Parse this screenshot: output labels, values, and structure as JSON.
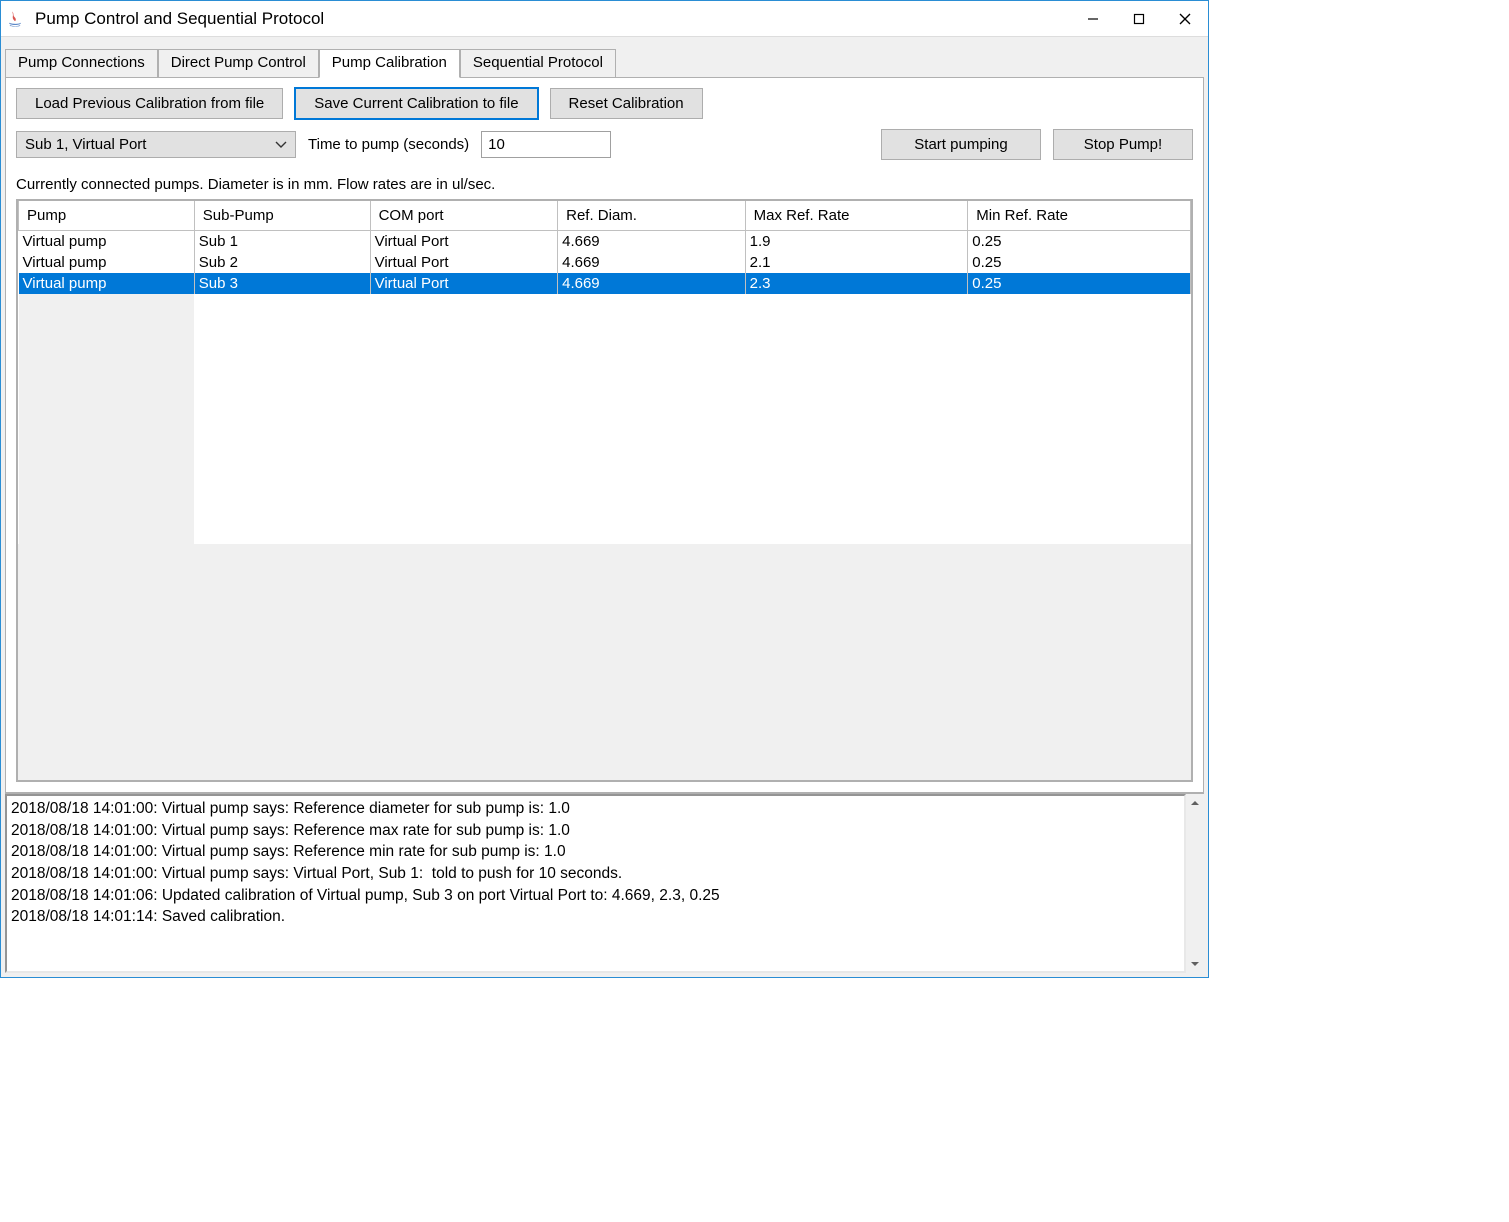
{
  "window": {
    "title": "Pump Control and Sequential Protocol"
  },
  "tabs": [
    {
      "label": "Pump Connections",
      "active": false
    },
    {
      "label": "Direct Pump Control",
      "active": false
    },
    {
      "label": "Pump Calibration",
      "active": true
    },
    {
      "label": "Sequential Protocol",
      "active": false
    }
  ],
  "toolbar": {
    "load_label": "Load Previous Calibration from file",
    "save_label": "Save Current Calibration to file",
    "reset_label": "Reset Calibration"
  },
  "controls": {
    "pump_select_value": "Sub 1, Virtual Port",
    "time_label": "Time to pump (seconds)",
    "time_value": "10",
    "start_label": "Start pumping",
    "stop_label": "Stop Pump!"
  },
  "info_label": "Currently connected pumps. Diameter is in mm. Flow rates are in ul/sec.",
  "table": {
    "headers": [
      "Pump",
      "Sub-Pump",
      "COM port",
      "Ref. Diam.",
      "Max Ref. Rate",
      "Min Ref. Rate"
    ],
    "rows": [
      {
        "cells": [
          "Virtual pump",
          "Sub 1",
          "Virtual Port",
          "4.669",
          "1.9",
          "0.25"
        ],
        "selected": false
      },
      {
        "cells": [
          "Virtual pump",
          "Sub 2",
          "Virtual Port",
          "4.669",
          "2.1",
          "0.25"
        ],
        "selected": false
      },
      {
        "cells": [
          "Virtual pump",
          "Sub 3",
          "Virtual Port",
          "4.669",
          "2.3",
          "0.25"
        ],
        "selected": true
      }
    ]
  },
  "log": {
    "lines": [
      "2018/08/18 14:01:00: Virtual pump says: Reference diameter for sub pump is: 1.0",
      "2018/08/18 14:01:00: Virtual pump says: Reference max rate for sub pump is: 1.0",
      "2018/08/18 14:01:00: Virtual pump says: Reference min rate for sub pump is: 1.0",
      "2018/08/18 14:01:00: Virtual pump says: Virtual Port, Sub 1:  told to push for 10 seconds.",
      "2018/08/18 14:01:06: Updated calibration of Virtual pump, Sub 3 on port Virtual Port to: 4.669, 2.3, 0.25",
      "2018/08/18 14:01:14: Saved calibration."
    ]
  }
}
